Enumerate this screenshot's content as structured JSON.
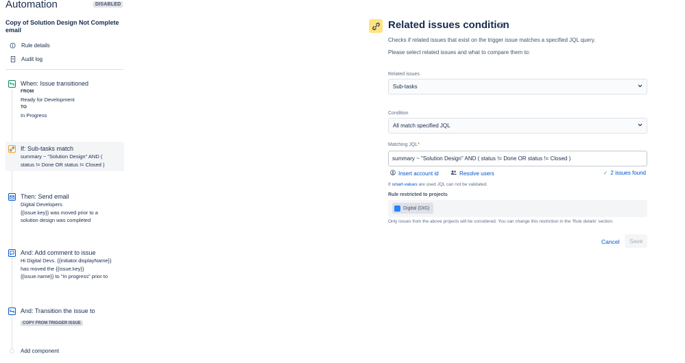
{
  "header": {
    "title": "Automation",
    "status_badge": "DISABLED"
  },
  "rule": {
    "name": "Copy of Solution Design Not Complete email"
  },
  "nav": {
    "rule_details": "Rule details",
    "audit_log": "Audit log"
  },
  "steps": {
    "trigger": {
      "title": "When: Issue transitioned",
      "from_label": "FROM",
      "from_value": "Ready for Development",
      "to_label": "TO",
      "to_value": "In Progress"
    },
    "condition": {
      "title": "If: Sub-tasks match",
      "line1": "summary ~ \"Solution Design\" AND (",
      "line2": "status != Done OR status != Closed )"
    },
    "email": {
      "title": "Then: Send email",
      "line1": "Digital Developers",
      "line2": "{{issue.key}} was moved prior to a",
      "line3": "solution design was completed"
    },
    "comment": {
      "title": "And: Add comment to issue",
      "line1": "Hi Digital Devs. {{initiator.displayName}}",
      "line2": "has moved the {{issue.key}}",
      "line3": "{{issue.name}} to \"In progress\" prior to"
    },
    "transition": {
      "title": "And: Transition the issue to",
      "badge": "COPY FROM TRIGGER ISSUE"
    },
    "add_component": "Add component"
  },
  "panel": {
    "title": "Related issues condition",
    "desc1": "Checks if related issues that exist on the trigger issue matches a specified JQL query.",
    "desc2": "Please select related issues and what to compare them to:",
    "related_label": "Related issues",
    "related_value": "Sub-tasks",
    "condition_label": "Condition",
    "condition_value": "All match specified JQL",
    "jql_label": "Matching JQL",
    "jql_required": "*",
    "jql_value": "summary ~ \"Solution Design\" AND  ( status != Done OR status != Closed )",
    "insert_account": "Insert account id",
    "resolve_users": "Resolve users",
    "issues_found": "2 issues found",
    "note_prefix": "If",
    "note_link": "smart-values",
    "note_suffix": "are used JQL can not be validated.",
    "restricted_label": "Rule restricted to projects",
    "project_chip": "Digital (DIG)",
    "restriction_note": "Only issues from the above projects will be considered. You can change this restriction in the 'Rule details' section.",
    "cancel": "Cancel",
    "save": "Save"
  },
  "colors": {
    "link": "#0052cc",
    "condition_accent": "#ffe380",
    "success": "#36b37e"
  }
}
